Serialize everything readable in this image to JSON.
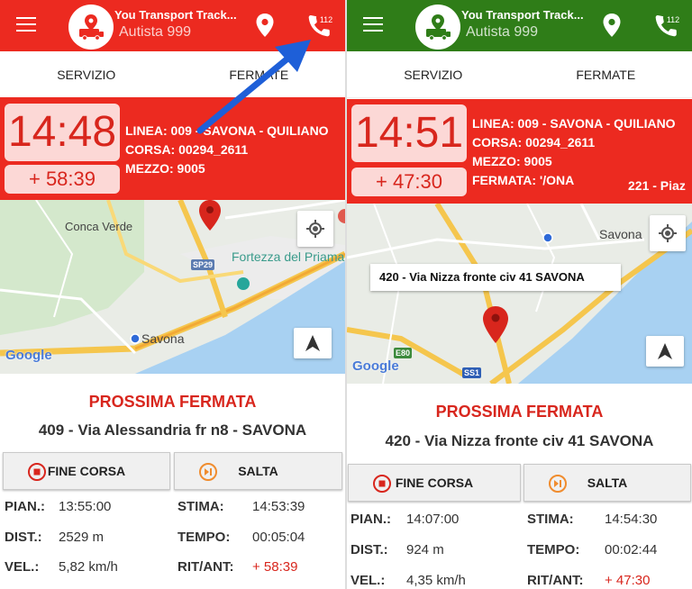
{
  "left": {
    "header": {
      "title": "You Transport Track...",
      "subtitle": "Autista 999",
      "color": "#ec2a20"
    },
    "tabs": [
      "SERVIZIO",
      "FERMATE"
    ],
    "info": {
      "time": "14:48",
      "delay": "+ 58:39",
      "linea": "LINEA: 009 - SAVONA - QUILIANO",
      "corsa": "CORSA: 00294_2611",
      "mezzo": "MEZZO: 9005"
    },
    "map": {
      "labels": {
        "conca_verde": "Conca Verde",
        "fortezza": "Fortezza del Priama",
        "savona": "Savona",
        "sp29": "SP29"
      },
      "google": "Google"
    },
    "next": {
      "title": "PROSSIMA FERMATA",
      "stop": "409 - Via Alessandria fr n8 - SAVONA"
    },
    "buttons": {
      "fine_corsa": "FINE CORSA",
      "salta": "SALTA"
    },
    "stats": {
      "pian_label": "PIAN.:",
      "pian": "13:55:00",
      "stima_label": "STIMA:",
      "stima": "14:53:39",
      "dist_label": "DIST.:",
      "dist": "2529 m",
      "tempo_label": "TEMPO:",
      "tempo": "00:05:04",
      "vel_label": "VEL.:",
      "vel": "5,82 km/h",
      "rit_label": "RIT/ANT:",
      "rit": "+ 58:39"
    }
  },
  "right": {
    "header": {
      "title": "You Transport Track...",
      "subtitle": "Autista 999",
      "color": "#2f7d18"
    },
    "tabs": [
      "SERVIZIO",
      "FERMATE"
    ],
    "info": {
      "time": "14:51",
      "delay": "+ 47:30",
      "linea": "LINEA: 009 - SAVONA - QUILIANO",
      "corsa": "CORSA: 00294_2611",
      "mezzo": "MEZZO: 9005",
      "fermata": "FERMATA: '/ONA",
      "fermata_right": "221 - Piaz"
    },
    "map": {
      "labels": {
        "savona": "Savona",
        "e80": "E80",
        "ss1": "SS1"
      },
      "callout": "420 - Via Nizza fronte civ 41 SAVONA",
      "google": "Google"
    },
    "next": {
      "title": "PROSSIMA FERMATA",
      "stop": "420 - Via Nizza fronte civ 41 SAVONA"
    },
    "buttons": {
      "fine_corsa": "FINE CORSA",
      "salta": "SALTA"
    },
    "stats": {
      "pian_label": "PIAN.:",
      "pian": "14:07:00",
      "stima_label": "STIMA:",
      "stima": "14:54:30",
      "dist_label": "DIST.:",
      "dist": "924 m",
      "tempo_label": "TEMPO:",
      "tempo": "00:02:44",
      "vel_label": "VEL.:",
      "vel": "4,35 km/h",
      "rit_label": "RIT/ANT:",
      "rit": "+ 47:30"
    }
  },
  "call_icon_badge": "112",
  "colors": {
    "accent_red": "#ec2a20",
    "accent_green": "#2f7d18",
    "arrow_blue": "#1e5fd8"
  }
}
